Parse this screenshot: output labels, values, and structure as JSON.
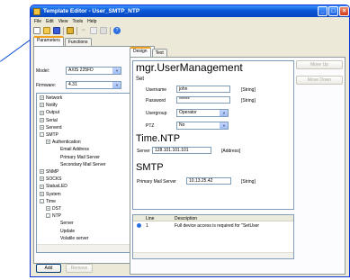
{
  "window": {
    "title": "Template Editor - User_SMTP_NTP"
  },
  "titlebar_buttons": {
    "min": "_",
    "max": "□",
    "close": "×"
  },
  "menu": [
    "File",
    "Edit",
    "View",
    "Tools",
    "Help"
  ],
  "toolbar_icons": [
    "new-icon",
    "open-icon",
    "save-icon",
    "lock-icon",
    "cut-icon",
    "copy-icon",
    "paste-icon",
    "help-icon"
  ],
  "left_tabs": [
    "Parameters",
    "Functions"
  ],
  "model": {
    "label": "Model:",
    "value": "AXIS 225FD"
  },
  "firmware": {
    "label": "Firmware:",
    "value": "4.31"
  },
  "tree": [
    {
      "label": "Network",
      "expander": "+",
      "level": 0
    },
    {
      "label": "Notify",
      "expander": "+",
      "level": 0
    },
    {
      "label": "Output",
      "expander": "+",
      "level": 0
    },
    {
      "label": "Serial",
      "expander": "+",
      "level": 0
    },
    {
      "label": "Serverd",
      "expander": "+",
      "level": 0
    },
    {
      "label": "SMTP",
      "expander": "-",
      "level": 0
    },
    {
      "label": "Authentication",
      "expander": "+",
      "level": 1
    },
    {
      "label": "Email Address",
      "expander": "",
      "level": 2
    },
    {
      "label": "Primary Mail Server",
      "expander": "",
      "level": 2
    },
    {
      "label": "Secondary Mail Server",
      "expander": "",
      "level": 2
    },
    {
      "label": "SNMP",
      "expander": "+",
      "level": 0
    },
    {
      "label": "SOCKS",
      "expander": "+",
      "level": 0
    },
    {
      "label": "StatusLED",
      "expander": "+",
      "level": 0
    },
    {
      "label": "System",
      "expander": "+",
      "level": 0
    },
    {
      "label": "Time",
      "expander": "-",
      "level": 0
    },
    {
      "label": "DST",
      "expander": "+",
      "level": 1
    },
    {
      "label": "NTP",
      "expander": "-",
      "level": 1
    },
    {
      "label": "Server",
      "expander": "",
      "level": 2
    },
    {
      "label": "Update",
      "expander": "",
      "level": 2
    },
    {
      "label": "Volatile server",
      "expander": "",
      "level": 2
    }
  ],
  "left_buttons": {
    "add": "Add",
    "remove": "Remove"
  },
  "right_tabs": [
    "Design",
    "Text"
  ],
  "design": {
    "heading1": "mgr.UserManagement",
    "section_set": "Set",
    "username": {
      "label": "Username",
      "value": "john",
      "type": "[String]"
    },
    "password": {
      "label": "Password",
      "value": "******",
      "type": "[String]"
    },
    "usergroup": {
      "label": "Usergroup",
      "value": "Operator"
    },
    "ptz": {
      "label": "PTZ",
      "value": "No"
    },
    "heading2": "Time.NTP",
    "server": {
      "label": "Server",
      "value": "128.101.101.101",
      "type": "[Address]"
    },
    "heading3": "SMTP",
    "primary_mail": {
      "label": "Primary Mail Server",
      "value": "10.13.25.42",
      "type": "[String]"
    }
  },
  "side_buttons": {
    "move_up": "Move Up",
    "move_down": "Move Down"
  },
  "messages": {
    "headers": [
      "Line",
      "Description"
    ],
    "rows": [
      {
        "icon": "info-icon",
        "line": "1",
        "description": "Full device access is required for \"SetUser"
      }
    ]
  },
  "colors": {
    "title_blue": "#0a57d6",
    "frame": "#0831d9",
    "face": "#ece9d8",
    "tab_highlight": "#f0a020"
  }
}
